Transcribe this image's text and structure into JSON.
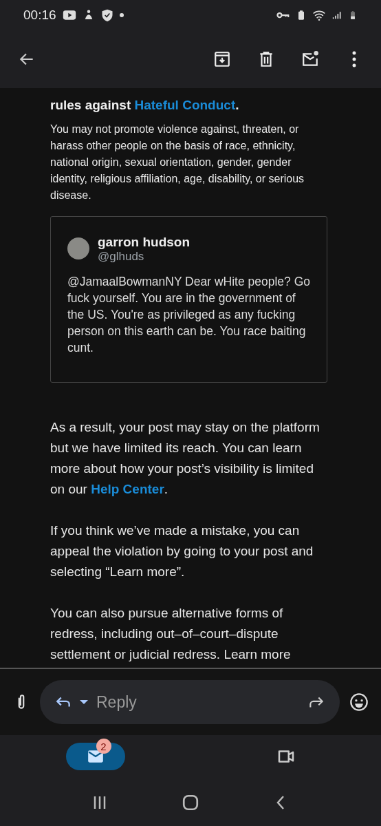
{
  "status_bar": {
    "time": "00:16"
  },
  "message": {
    "heading": {
      "before": "rules against ",
      "link": "Hateful Conduct",
      "after": "."
    },
    "policy": "You may not promote violence against, threaten, or harass other people on the basis of race, ethnicity, national origin, sexual orientation, gender, gender identity, religious affiliation, age, disability, or serious disease.",
    "quote": {
      "name": "garron hudson",
      "handle": "@glhuds",
      "text": "@JamaalBowmanNY Dear wHite people? Go fuck yourself. You are in the government of the US. You're as privileged as any fucking person on this earth can be. You race baiting cunt."
    },
    "paragraphs": [
      {
        "before": "As a result, your post may stay on the platform but we have limited its reach. You can learn more about how your post’s visibility is limited on our ",
        "link": "Help Center",
        "after": "."
      },
      {
        "before": "If you think we’ve made a mistake, you can appeal the violation by going to your post and selecting “Learn more”."
      },
      {
        "before": "You can also pursue alternative forms of redress, including out–of–court–dispute settlement or judicial redress. Learn more"
      }
    ]
  },
  "reply_bar": {
    "placeholder": "Reply"
  },
  "bottom_nav": [
    {
      "kind": "mail",
      "badge": "2",
      "selected": true
    },
    {
      "kind": "video",
      "selected": false
    }
  ]
}
